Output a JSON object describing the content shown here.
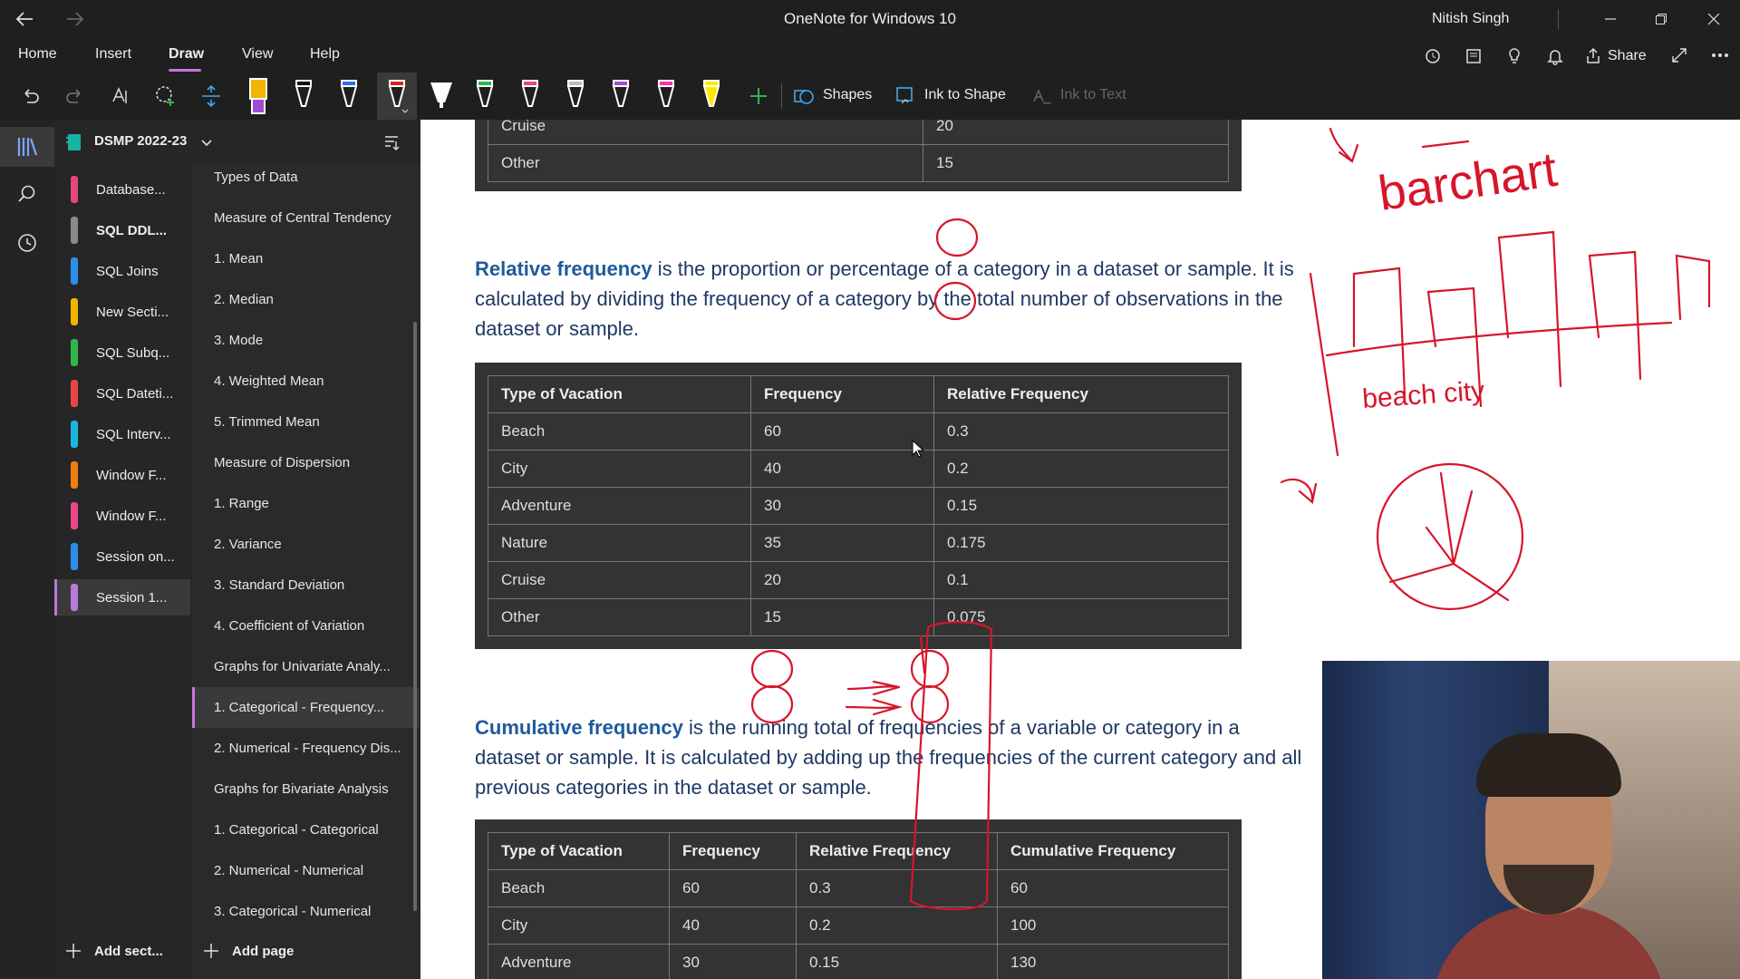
{
  "titlebar": {
    "title": "OneNote for Windows 10",
    "user": "Nitish Singh"
  },
  "menu": {
    "items": [
      "Home",
      "Insert",
      "Draw",
      "View",
      "Help"
    ],
    "active": "Draw",
    "share_label": "Share"
  },
  "toolbar": {
    "shapes_label": "Shapes",
    "ink_to_shape_label": "Ink to Shape",
    "ink_to_text_label": "Ink to Text"
  },
  "notebook": {
    "name": "DSMP 2022-23"
  },
  "sections": [
    {
      "label": "Database...",
      "color": "#e8477a"
    },
    {
      "label": "SQL DDL...",
      "color": "#8a8a8a"
    },
    {
      "label": "SQL Joins",
      "color": "#2b8ee8"
    },
    {
      "label": "New Secti...",
      "color": "#f2b500"
    },
    {
      "label": "SQL Subq...",
      "color": "#2fb64a"
    },
    {
      "label": "SQL Dateti...",
      "color": "#e84646"
    },
    {
      "label": "SQL Interv...",
      "color": "#18b7e0"
    },
    {
      "label": "Window F...",
      "color": "#f07e13"
    },
    {
      "label": "Window F...",
      "color": "#e8478a"
    },
    {
      "label": "Session on...",
      "color": "#2b8ee8"
    },
    {
      "label": "Session 1...",
      "color": "#b97ad9"
    }
  ],
  "pages": [
    "Types of Data",
    "Measure of Central Tendency",
    "1. Mean",
    "2. Median",
    "3. Mode",
    "4. Weighted Mean",
    "5. Trimmed Mean",
    "Measure of Dispersion",
    "1. Range",
    "2. Variance",
    "3. Standard Deviation",
    "4. Coefficient of Variation",
    "Graphs for Univariate Analy...",
    "1. Categorical - Frequency...",
    "2. Numerical - Frequency Dis...",
    "Graphs for Bivariate Analysis",
    "1. Categorical - Categorical",
    "2. Numerical - Numerical",
    "3. Categorical - Numerical"
  ],
  "bottom": {
    "add_section": "Add sect...",
    "add_page": "Add page"
  },
  "content": {
    "top_table_rows": [
      [
        "Cruise",
        "20"
      ],
      [
        "Other",
        "15"
      ]
    ],
    "relative_bold": "Relative frequency",
    "relative_text": " is the proportion or percentage of a category in a dataset or sample. It is calculated by dividing the frequency of a category by the total number of observations in the dataset or sample.",
    "rel_table": {
      "headers": [
        "Type of Vacation",
        "Frequency",
        "Relative Frequency"
      ],
      "rows": [
        [
          "Beach",
          "60",
          "0.3"
        ],
        [
          "City",
          "40",
          "0.2"
        ],
        [
          "Adventure",
          "30",
          "0.15"
        ],
        [
          "Nature",
          "35",
          "0.175"
        ],
        [
          "Cruise",
          "20",
          "0.1"
        ],
        [
          "Other",
          "15",
          "0.075"
        ]
      ]
    },
    "cumulative_bold": "Cumulative frequency",
    "cumulative_text": " is the running total of frequencies of a variable or category in a dataset or sample. It is calculated by adding up the frequencies of the current category and all previous categories in the dataset or sample.",
    "cum_table": {
      "headers": [
        "Type of Vacation",
        "Frequency",
        "Relative Frequency",
        "Cumulative Frequency"
      ],
      "rows": [
        [
          "Beach",
          "60",
          "0.3",
          "60"
        ],
        [
          "City",
          "40",
          "0.2",
          "100"
        ],
        [
          "Adventure",
          "30",
          "0.15",
          "130"
        ]
      ]
    },
    "ink_barchart": "barchart",
    "ink_axis": "beach city"
  }
}
